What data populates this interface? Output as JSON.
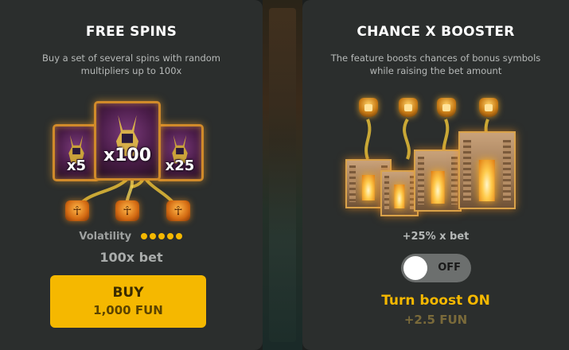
{
  "free_spins": {
    "title": "FREE SPINS",
    "description": "Buy a set of several spins with random multipliers up to 100x",
    "cards": [
      {
        "multiplier": "x5"
      },
      {
        "multiplier": "x100"
      },
      {
        "multiplier": "x25"
      }
    ],
    "badges": [
      {
        "icon": "ankh-icon"
      },
      {
        "icon": "ankh-icon"
      },
      {
        "icon": "ankh-icon"
      }
    ],
    "volatility_label": "Volatility",
    "volatility_level": 5,
    "volatility_max": 5,
    "cost_label": "100x bet",
    "buy_button": {
      "label": "BUY",
      "price": "1,000 FUN"
    },
    "accent_color": "#f5b800"
  },
  "booster": {
    "title": "CHANCE X BOOSTER",
    "description": "The feature boosts chances of bonus symbols while raising the bet amount",
    "urns": [
      {
        "icon": "golden-urn-icon"
      },
      {
        "icon": "golden-urn-icon"
      },
      {
        "icon": "golden-urn-icon"
      },
      {
        "icon": "golden-urn-icon"
      }
    ],
    "increase_label": "+25% x bet",
    "toggle": {
      "state_label": "OFF",
      "on": false
    },
    "action_label": "Turn boost ON",
    "extra_cost": "+2.5 FUN"
  }
}
